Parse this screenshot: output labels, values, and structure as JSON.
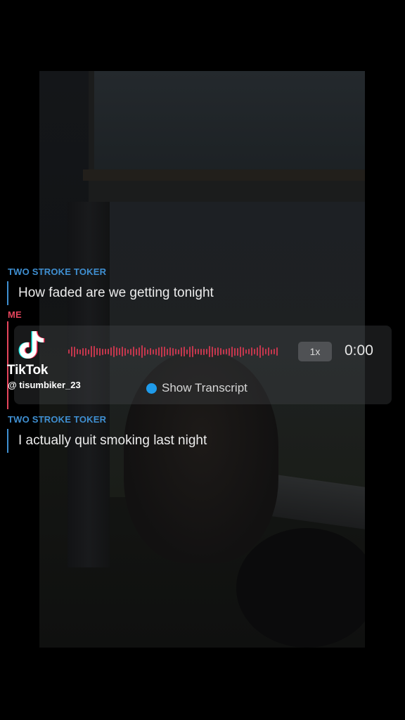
{
  "chat": {
    "messages": [
      {
        "sender": "TWO STROKE TOKER",
        "text": "How faded are we getting tonight"
      },
      {
        "sender": "ME",
        "voice_note": true
      },
      {
        "sender": "TWO STROKE TOKER",
        "text": "I actually quit smoking last night"
      }
    ]
  },
  "voice_note": {
    "speed_label": "1x",
    "duration": "0:00",
    "transcript_label": "Show Transcript"
  },
  "watermark": {
    "brand": "TikTok",
    "username": "@ tisumbiker_23"
  },
  "colors": {
    "them_accent": "#3f8fd1",
    "me_accent": "#e5455c",
    "transcript_dot": "#1f9bea"
  },
  "icons": [
    "tiktok-logo-icon",
    "transcript-dot-icon"
  ]
}
